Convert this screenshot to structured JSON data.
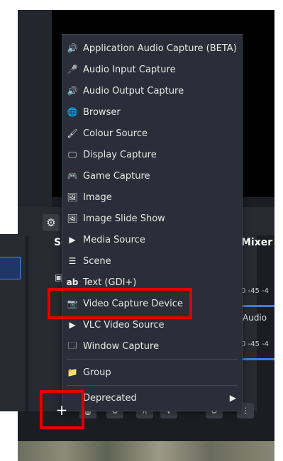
{
  "controls": {
    "settings_icon": "⚙"
  },
  "scenes_dock": {
    "header_icon": "⧉"
  },
  "sources_dock": {
    "title": "So",
    "row_icon": "▣"
  },
  "mixer": {
    "title": "Mixer",
    "channel1_ticks": "0 -45 -4",
    "channel2_label": "Audio",
    "channel2_ticks": "0 -45 -4"
  },
  "menu": {
    "items": [
      {
        "label": "Application Audio Capture (BETA)",
        "icon": "app-audio-icon",
        "glyph": "🔊"
      },
      {
        "label": "Audio Input Capture",
        "icon": "microphone-icon",
        "glyph": "🎤"
      },
      {
        "label": "Audio Output Capture",
        "icon": "speaker-icon",
        "glyph": "🔊"
      },
      {
        "label": "Browser",
        "icon": "globe-icon",
        "glyph": "🌐"
      },
      {
        "label": "Colour Source",
        "icon": "paintbrush-icon",
        "glyph": "🖌"
      },
      {
        "label": "Display Capture",
        "icon": "monitor-icon",
        "glyph": "🖵"
      },
      {
        "label": "Game Capture",
        "icon": "gamepad-icon",
        "glyph": "🎮"
      },
      {
        "label": "Image",
        "icon": "image-icon",
        "glyph": "🖼"
      },
      {
        "label": "Image Slide Show",
        "icon": "slideshow-icon",
        "glyph": "🖼"
      },
      {
        "label": "Media Source",
        "icon": "play-icon",
        "glyph": "▶"
      },
      {
        "label": "Scene",
        "icon": "list-icon",
        "glyph": "☰"
      },
      {
        "label": "Text (GDI+)",
        "icon": "text-icon",
        "glyph": "ab"
      },
      {
        "label": "Video Capture Device",
        "icon": "camera-icon",
        "glyph": "📷"
      },
      {
        "label": "VLC Video Source",
        "icon": "play-icon",
        "glyph": "▶"
      },
      {
        "label": "Window Capture",
        "icon": "window-icon",
        "glyph": "🗔"
      }
    ],
    "group": {
      "label": "Group",
      "glyph": "📁"
    },
    "deprecated": {
      "label": "Deprecated",
      "arrow": "▶"
    }
  },
  "toolbar": {
    "add_glyph": "+",
    "remove_glyph": "🗑",
    "props_glyph": "⚙",
    "up_glyph": "∧",
    "down_glyph": "∨",
    "more_glyph": "⋮"
  },
  "colors": {
    "highlight": "#e20000",
    "accent": "#4a8cf6"
  }
}
